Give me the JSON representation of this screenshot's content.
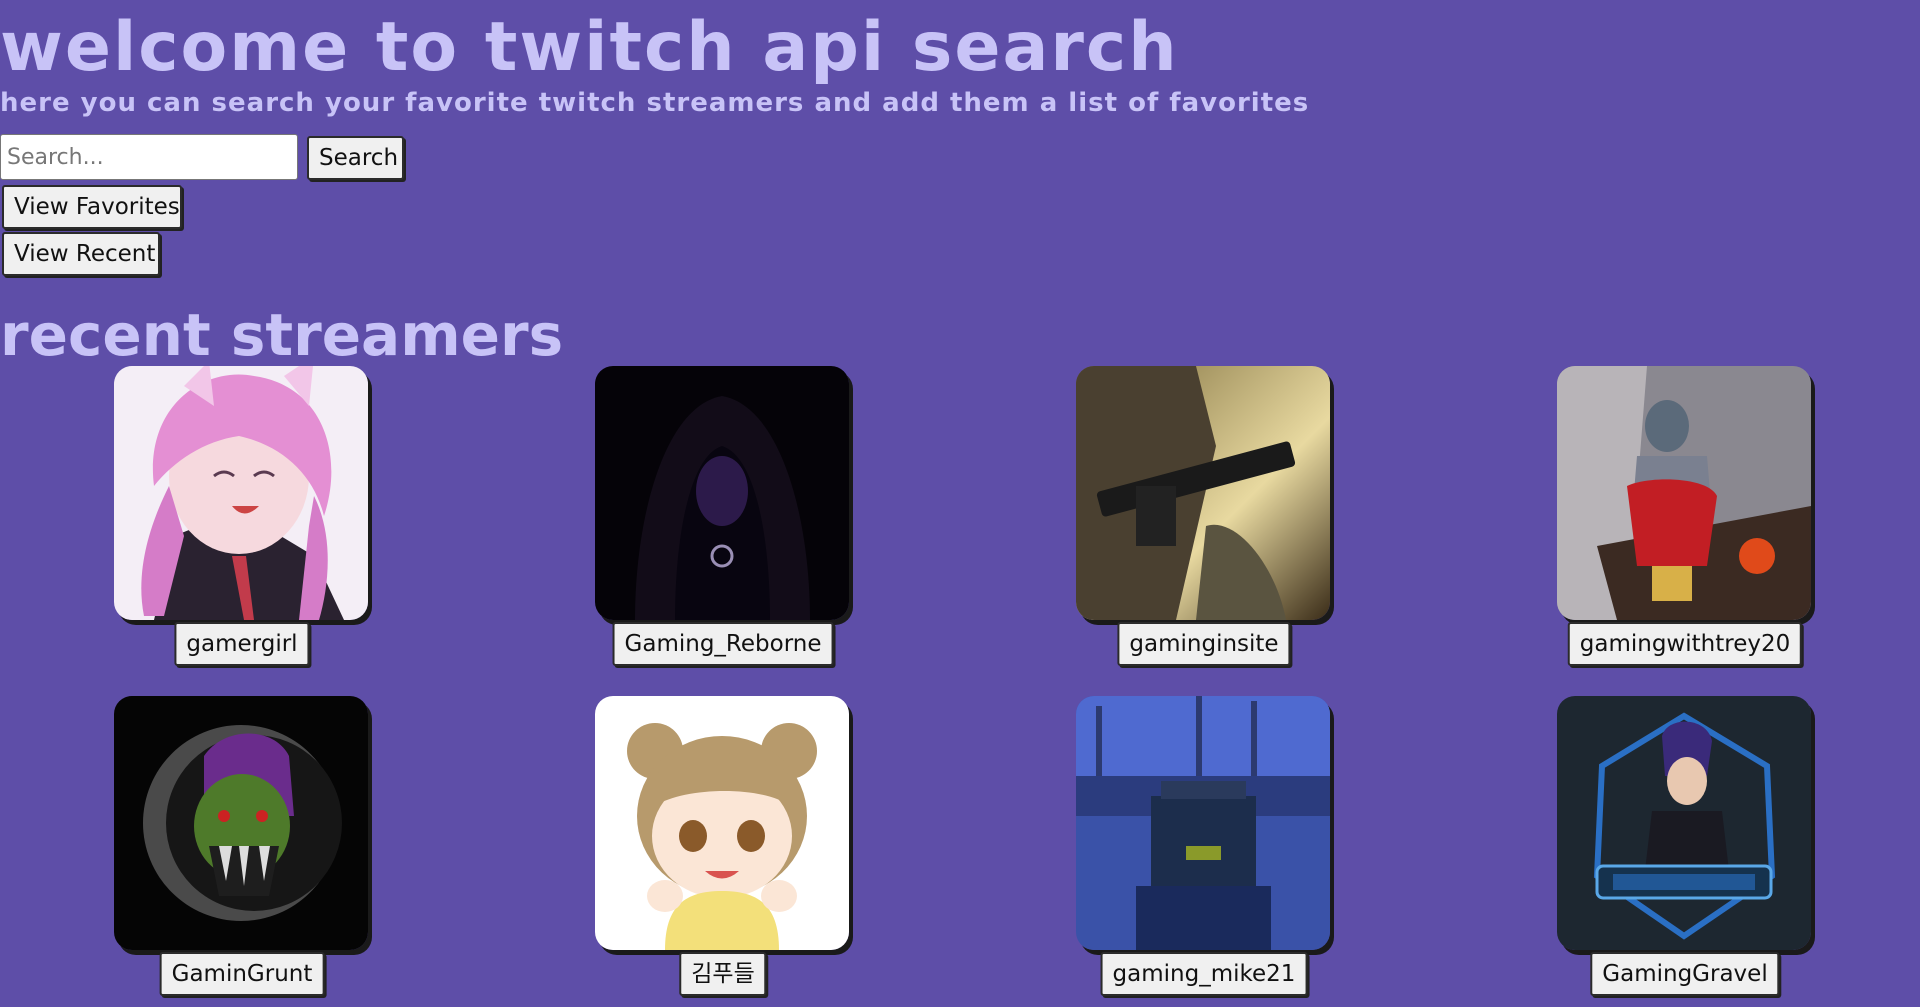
{
  "header": {
    "title": "Welcome to Twitch API Search",
    "subtitle": "Here you can search your favorite Twitch streamers and add them a list of favorites"
  },
  "search": {
    "placeholder": "Search...",
    "value": "",
    "button_label": "Search"
  },
  "nav": {
    "favorites_label": "View Favorites",
    "recent_label": "View Recent"
  },
  "section": {
    "title": "Recent Streamers"
  },
  "streamers": [
    {
      "name": "gamergirl"
    },
    {
      "name": "Gaming_Reborne"
    },
    {
      "name": "gaminginsite"
    },
    {
      "name": "gamingwithtrey20"
    },
    {
      "name": "GaminGrunt"
    },
    {
      "name": "김푸들"
    },
    {
      "name": "gaming_mike21"
    },
    {
      "name": "GamingGravel"
    }
  ],
  "colors": {
    "background": "#5e4ea8",
    "heading": "#c8c3f7",
    "button_bg": "#f0f0f0"
  }
}
